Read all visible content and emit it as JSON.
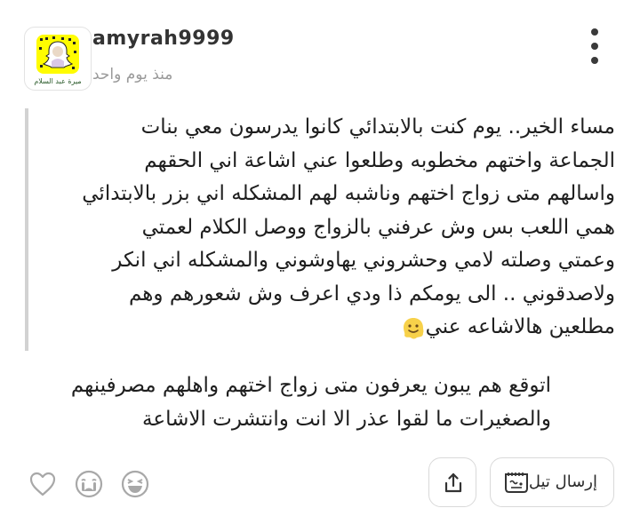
{
  "post": {
    "username": "amyrah9999",
    "timestamp": "منذ يوم واحد",
    "avatar_caption": "ميرة عبد السلام",
    "quote_text": "مساء الخير.. يوم كنت بالابتدائي كانوا يدرسون معي بنات\nالجماعة واختهم مخطوبه وطلعوا عني اشاعة اني الحقهم\nواسالهم متى زواج اختهم وناشبه لهم المشكله اني بزر بالابتدائي\nهمي اللعب بس وش عرفني بالزواج ووصل الكلام لعمتي\nوعمتي وصلته لامي وحشروني يهاوشوني والمشكله اني انكر\nولاصدقوني .. الى يومكم ذا ودي اعرف وش شعورهم وهم\nمطلعين هالاشاعه عني",
    "body_text": "اتوقع هم يبون يعرفون متى زواج اختهم واهلهم مصرفينهم\nوالصغيرات ما لقوا عذر الا انت وانتشرت الاشاعة"
  },
  "actions": {
    "send_label": "إرسال تيل",
    "icons": [
      "heart-icon",
      "crying-face-icon",
      "laughing-face-icon",
      "share-icon",
      "tell-icon"
    ]
  },
  "colors": {
    "quote_bar": "#d2d2d2",
    "snap_yellow": "#fffc00",
    "emoji_yellow": "#f7d14a"
  }
}
